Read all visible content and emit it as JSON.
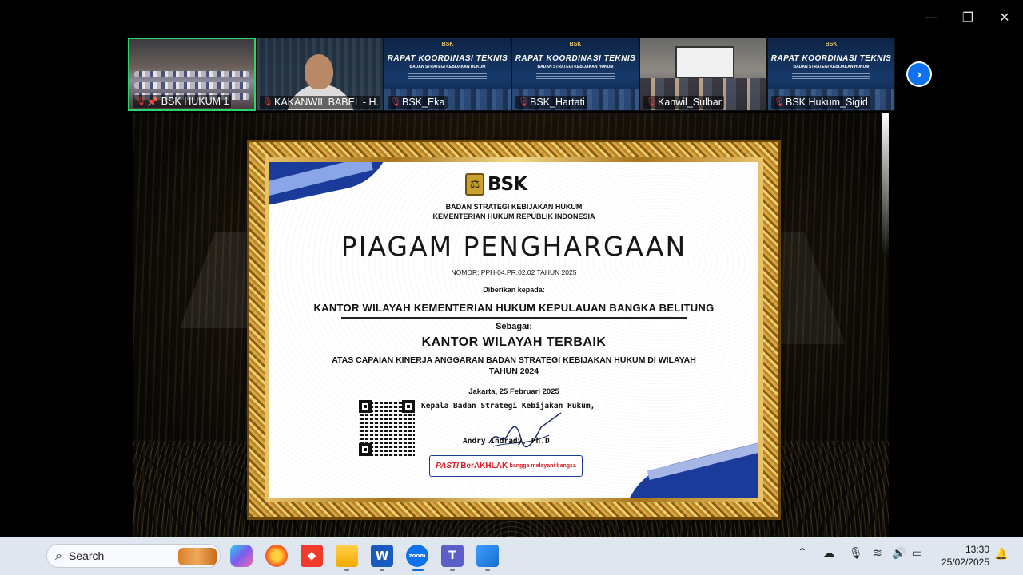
{
  "window": {
    "controls": {
      "minimize": "—",
      "restore": "❐",
      "close": "✕"
    }
  },
  "participants": [
    {
      "name": "BSK HUKUM 1",
      "muted": true,
      "pinned": true,
      "active": true,
      "view": "meeting-room"
    },
    {
      "name": "KAKANWIL BABEL - H...",
      "muted": true,
      "pinned": false,
      "active": false,
      "view": "person"
    },
    {
      "name": "BSK_Eka",
      "muted": true,
      "pinned": false,
      "active": false,
      "view": "slide"
    },
    {
      "name": "BSK_Hartati",
      "muted": true,
      "pinned": false,
      "active": false,
      "view": "slide"
    },
    {
      "name": "Kanwil_Sulbar",
      "muted": true,
      "pinned": false,
      "active": false,
      "view": "room"
    },
    {
      "name": "BSK Hukum_Sigid",
      "muted": true,
      "pinned": false,
      "active": false,
      "view": "slide"
    }
  ],
  "slide_thumb": {
    "logo": "BSK",
    "title": "RAPAT KOORDINASI TEKNIS",
    "subtitle": "BADAN STRATEGI KEBIJAKAN HUKUM"
  },
  "next_page_icon": "chevron-right-icon",
  "certificate": {
    "logo_text": "BSK",
    "org_line1": "BADAN STRATEGI KEBIJAKAN HUKUM",
    "org_line2": "KEMENTERIAN HUKUM REPUBLIK INDONESIA",
    "title": "PIAGAM PENGHARGAAN",
    "number": "NOMOR: PPH-04.PR.02.02 TAHUN 2025",
    "given_to_label": "Diberikan kepada:",
    "recipient": "KANTOR WILAYAH KEMENTERIAN HUKUM KEPULAUAN BANGKA BELITUNG",
    "as_label": "Sebagai:",
    "award": "KANTOR WILAYAH TERBAIK",
    "description_line1": "ATAS CAPAIAN KINERJA ANGGARAN BADAN STRATEGI KEBIJAKAN HUKUM DI WILAYAH",
    "description_line2": "TAHUN 2024",
    "place_date": "Jakarta, 25 Februari 2025",
    "signer_title": "Kepala Badan Strategi Kebijakan Hukum,",
    "signer_name": "Andry Indrady, Ph.D",
    "badge1": "PASTI",
    "badge2": "BerAKHLAK",
    "badge3": "bangga melayani bangsa"
  },
  "taskbar": {
    "search_label": "Search",
    "apps": [
      "copilot-icon",
      "firefox-icon",
      "anydesk-icon",
      "file-explorer-icon",
      "word-icon",
      "zoom-icon",
      "teams-icon",
      "photos-icon"
    ],
    "zoom_label": "zoom",
    "word_label": "W",
    "clock_time": "13:30",
    "clock_date": "25/02/2025"
  },
  "colors": {
    "active_border": "#2bd56b",
    "zoom_blue": "#0e72ed",
    "muted_red": "#e0393e",
    "cert_blue": "#1b3b9a"
  }
}
